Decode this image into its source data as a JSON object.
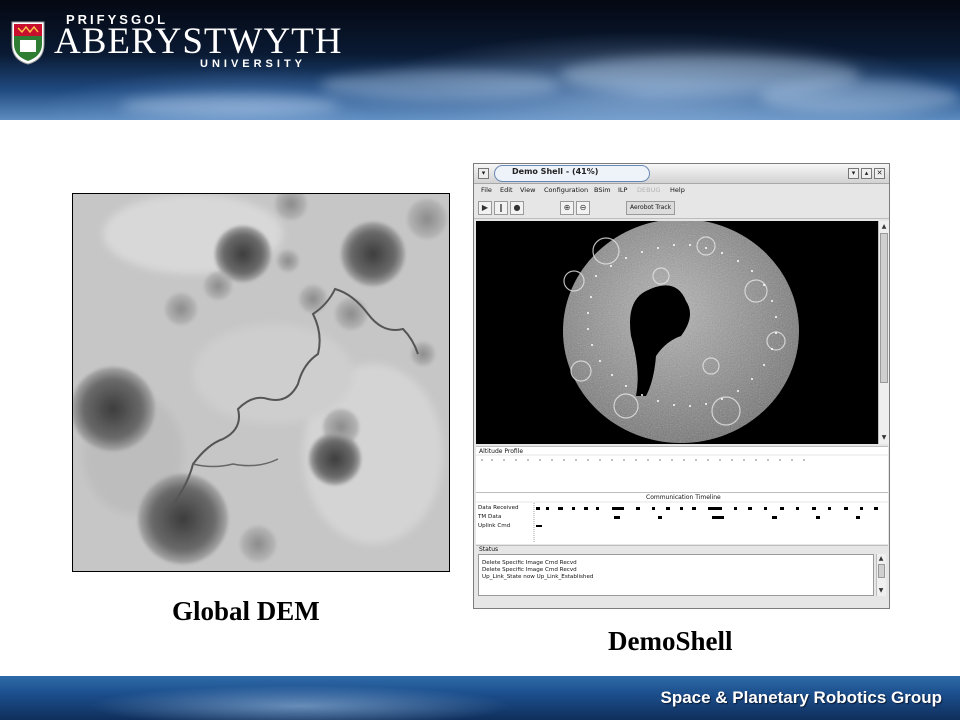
{
  "header": {
    "university_small": "PRIFYSGOL",
    "university_main": "ABERYSTWYTH",
    "university_sub": "UNIVERSITY"
  },
  "captions": {
    "global_dem": "Global DEM",
    "demoshell": "DemoShell"
  },
  "footer": {
    "group_name": "Space & Planetary Robotics Group"
  },
  "demoshell_window": {
    "title": "Demo Shell  -  (41%)",
    "title_buttons": [
      "▾",
      "▴",
      "✕"
    ],
    "menu": [
      {
        "label": "File",
        "enabled": true
      },
      {
        "label": "Edit",
        "enabled": true
      },
      {
        "label": "View",
        "enabled": true
      },
      {
        "label": "Configuration",
        "enabled": true
      },
      {
        "label": "BSim",
        "enabled": true
      },
      {
        "label": "ILP",
        "enabled": true
      },
      {
        "label": "DEBUG",
        "enabled": false
      },
      {
        "label": "Help",
        "enabled": true
      }
    ],
    "toolbar": {
      "buttons": [
        "play-icon",
        "pause-icon",
        "stop-icon",
        "zoom-in-icon",
        "zoom-out-icon"
      ],
      "aerobot_track_label": "Aerobot Track"
    },
    "altitude_profile_label": "Altitude Profile",
    "communication_timeline": {
      "title": "Communication Timeline",
      "rows": [
        "Data Received",
        "TM Data",
        "Uplink Cmd"
      ]
    },
    "status": {
      "label": "Status",
      "lines": [
        "Delete Specific Image Cmd Recvd",
        "Delete Specific Image Cmd Recvd",
        "Up_Link_State now Up_Link_Established"
      ]
    }
  },
  "colors": {
    "banner_dark": "#040812",
    "banner_light": "#5d8cc0",
    "footer_blue": "#1c4f8d",
    "window_bg": "#e6e6e6"
  }
}
